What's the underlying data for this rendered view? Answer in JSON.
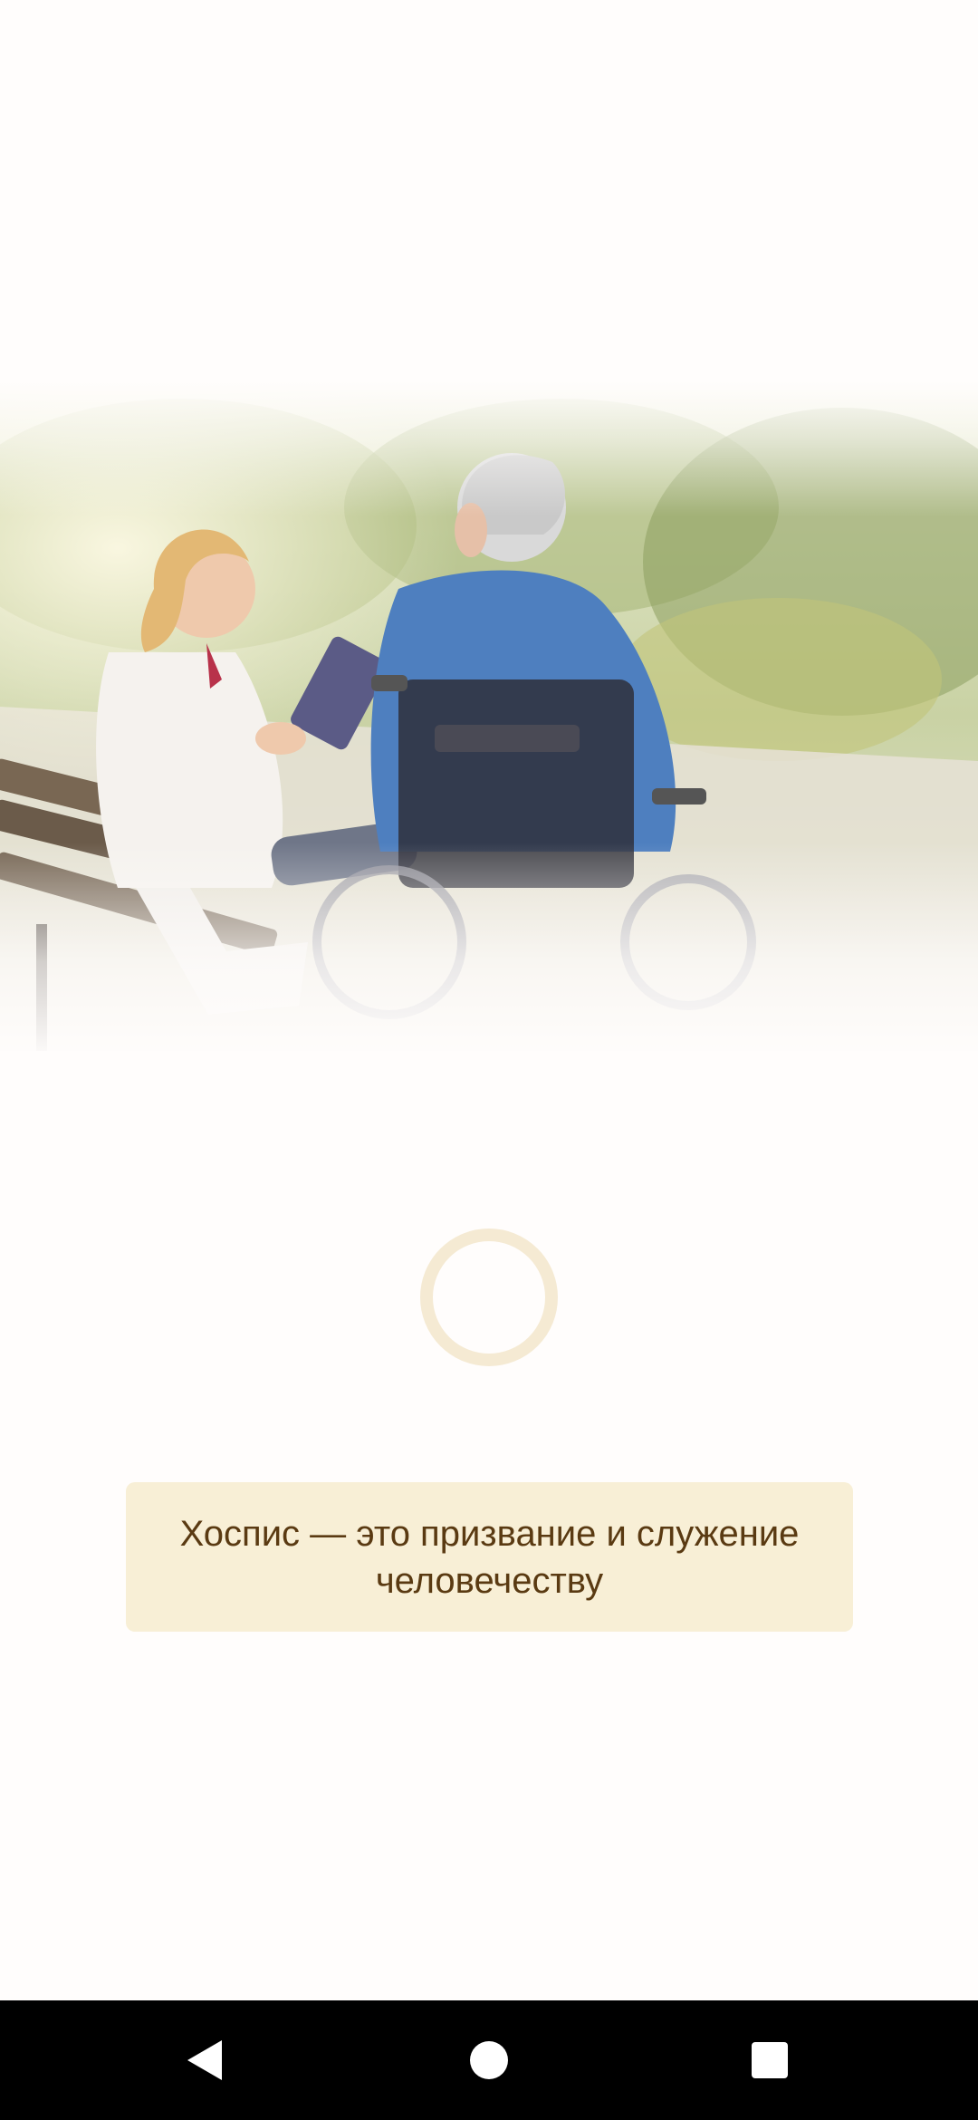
{
  "hero": {
    "icon": "photo-nurse-with-patient-in-wheelchair"
  },
  "loader": {
    "icon": "loading-ring-icon",
    "color": "#f5ead3"
  },
  "quote": {
    "text": "Хоспис — это призвание и служение человечеству",
    "background": "#f8efd6",
    "text_color": "#5a3a12"
  },
  "navigation": {
    "back_icon": "back-triangle-icon",
    "home_icon": "home-circle-icon",
    "recents_icon": "recents-square-icon"
  }
}
